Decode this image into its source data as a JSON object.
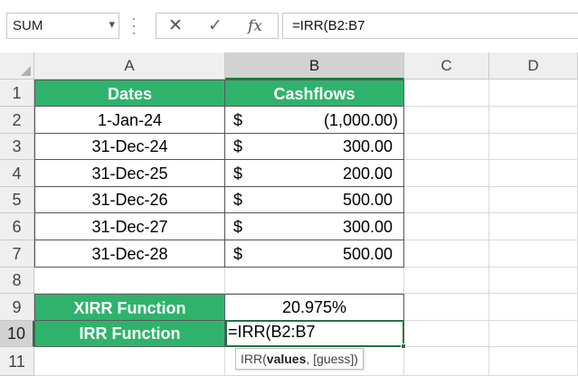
{
  "formula_bar": {
    "name_box": "SUM",
    "name_box_caret": "▾",
    "cancel_glyph": "✕",
    "enter_glyph": "✓",
    "fx_label": "fx",
    "formula": "=IRR(B2:B7"
  },
  "columns": [
    "A",
    "B",
    "C",
    "D"
  ],
  "rows": [
    "1",
    "2",
    "3",
    "4",
    "5",
    "6",
    "7",
    "8",
    "9",
    "10",
    "11"
  ],
  "table": {
    "header_dates": "Dates",
    "header_cashflows": "Cashflows",
    "currency": "$",
    "dates": [
      "1-Jan-24",
      "31-Dec-24",
      "31-Dec-25",
      "31-Dec-26",
      "31-Dec-27",
      "31-Dec-28"
    ],
    "cashflows": [
      "(1,000.00)",
      "300.00",
      "200.00",
      "500.00",
      "300.00",
      "500.00"
    ]
  },
  "xirr": {
    "label": "XIRR Function",
    "value": "20.975%"
  },
  "irr": {
    "label": "IRR Function",
    "editing_text": "=IRR(B2:B7"
  },
  "tooltip": {
    "func": "IRR(",
    "arg1": "values",
    "rest": ", [guess])"
  },
  "colors": {
    "header_green": "#2fb36c",
    "excel_green": "#217346"
  }
}
